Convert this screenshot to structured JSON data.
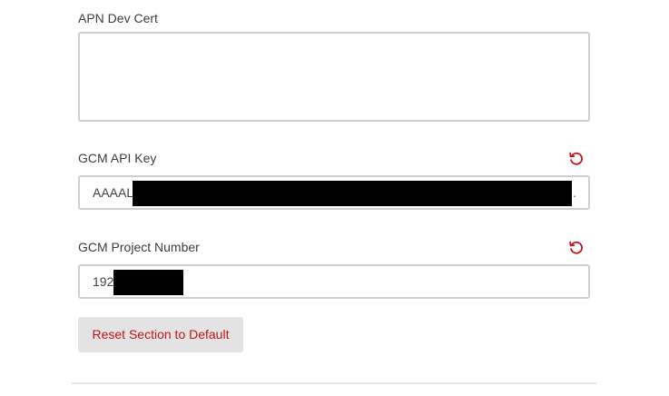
{
  "fields": {
    "apn_dev_cert": {
      "label": "APN Dev Cert",
      "value": ""
    },
    "gcm_api_key": {
      "label": "GCM API Key",
      "value_prefix": "AAAAL",
      "value_suffix": ".",
      "reset_icon": "undo-icon"
    },
    "gcm_project_number": {
      "label": "GCM Project Number",
      "value_prefix": "192",
      "reset_icon": "undo-icon"
    }
  },
  "actions": {
    "reset_section_label": "Reset Section to Default"
  },
  "colors": {
    "accent_red": "#c0161c",
    "border": "#cfcfcf",
    "button_bg": "#e3e3e3"
  }
}
